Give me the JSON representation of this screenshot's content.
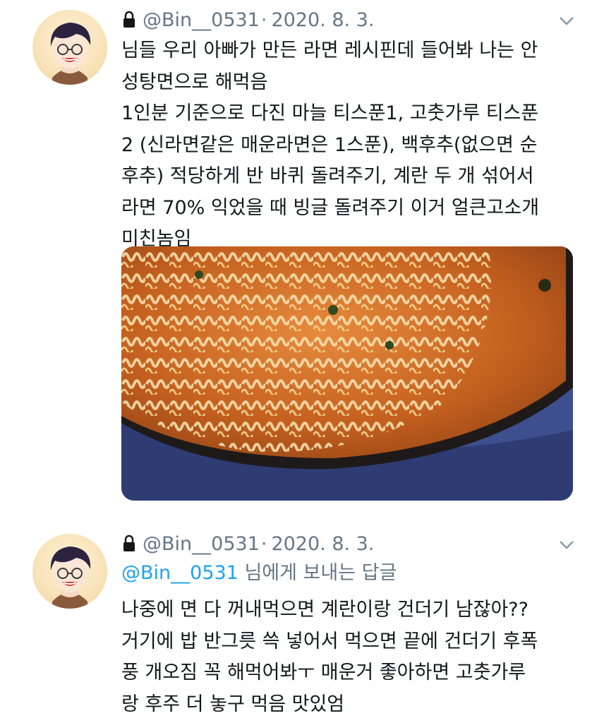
{
  "tweets": [
    {
      "author_handle": "@Bin__0531",
      "date": "2020. 8. 3.",
      "text": "님들 우리 아빠가 만든 라면 레시핀데 들어봐 나는 안\n성탕면으로 해먹음\n1인분 기준으로 다진 마늘 티스푼1, 고춧가루 티스푼\n2 (신라면같은 매운라면은 1스푼), 백후추(없으면 순\n후추) 적당하게 반 바퀴 돌려주기, 계란 두 개 섞어서\n라면 70% 익었을 때 빙글 돌려주기 이거 얼큰고소개\n미친놈임",
      "avatar_icon": "avatar-icon",
      "lock_icon": "lock-icon",
      "caret_icon": "chevron-down-icon"
    },
    {
      "author_handle": "@Bin__0531",
      "date": "2020. 8. 3.",
      "reply_mention": "@Bin__0531",
      "reply_suffix": " 님에게 보내는 답글",
      "text": "나중에 면 다 꺼내먹으면 계란이랑 건더기 남잖아??\n거기에 밥 반그릇 쓱 넣어서 먹으면 끝에 건더기 후폭\n풍 개오짐 꼭 해먹어봐ㅜ 매운거 좋아하면 고춧가루\n랑 후주 더 놓구 먹음 맛있엄",
      "avatar_icon": "avatar-icon",
      "lock_icon": "lock-icon",
      "caret_icon": "chevron-down-icon"
    }
  ],
  "colors": {
    "text": "#14171a",
    "secondary": "#657786",
    "link": "#1da1f2",
    "background": "#ffffff"
  }
}
